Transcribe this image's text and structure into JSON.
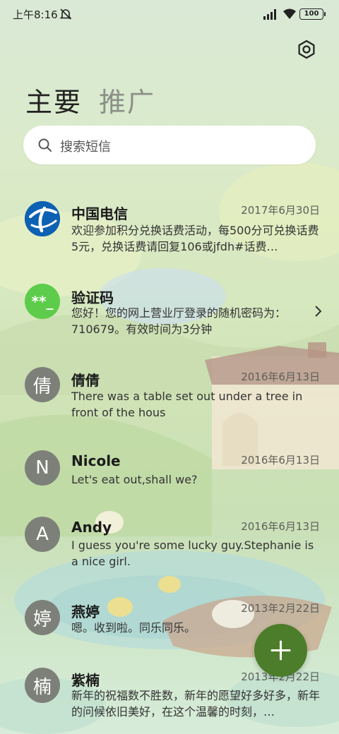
{
  "status_bar": {
    "time": "上午8:16",
    "battery": "100"
  },
  "tabs": [
    {
      "label": "主要"
    },
    {
      "label": "推广"
    }
  ],
  "search": {
    "placeholder": "搜索短信"
  },
  "conversations": [
    {
      "name": "中国电信",
      "date": "2017年6月30日",
      "message": "欢迎参加积分兑换话费活动，每500分可兑换话费5元，兑换话费请回复106或jfdh#话费…",
      "avatar_text": ""
    },
    {
      "name": "验证码",
      "date": "",
      "message": "您好！您的网上营业厅登录的随机密码为：710679。有效时间为3分钟",
      "avatar_text": "**_"
    },
    {
      "name": "倩倩",
      "date": "2016年6月13日",
      "message": "There was a table set out under a tree in front of the hous",
      "avatar_text": "倩"
    },
    {
      "name": "Nicole",
      "date": "2016年6月13日",
      "message": "Let's eat out,shall we?",
      "avatar_text": "N"
    },
    {
      "name": "Andy",
      "date": "2016年6月13日",
      "message": "I guess you're some lucky guy.Stephanie is a nice girl.",
      "avatar_text": "A"
    },
    {
      "name": "燕婷",
      "date": "2013年2月22日",
      "message": "嗯。收到啦。同乐同乐。",
      "avatar_text": "婷"
    },
    {
      "name": "紫楠",
      "date": "2013年2月22日",
      "message": "新年的祝福数不胜数，新年的愿望好多好多，新年的问候依旧美好，在这个温馨的时刻，…",
      "avatar_text": "楠"
    }
  ],
  "colors": {
    "accent": "#4c7d2a",
    "verify_avatar": "#5dcc4a",
    "telecom_blue": "#0c61b2",
    "avatar_gray": "#7d8079"
  }
}
